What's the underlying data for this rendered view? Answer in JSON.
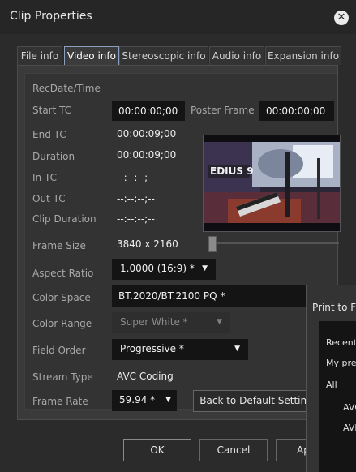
{
  "window": {
    "title": "Clip Properties",
    "close_icon": "close-icon"
  },
  "tabs": [
    {
      "label": "File info",
      "active": false
    },
    {
      "label": "Video info",
      "active": true
    },
    {
      "label": "Stereoscopic info",
      "active": false
    },
    {
      "label": "Audio info",
      "active": false
    },
    {
      "label": "Expansion info",
      "active": false
    }
  ],
  "fields": {
    "rec_datetime": {
      "label": "RecDate/Time"
    },
    "start_tc": {
      "label": "Start TC",
      "value": "00:00:00;00"
    },
    "poster_frame": {
      "label": "Poster Frame",
      "value": "00:00:00;00"
    },
    "end_tc": {
      "label": "End TC",
      "value": "00:00:09;00"
    },
    "duration": {
      "label": "Duration",
      "value": "00:00:09;00"
    },
    "in_tc": {
      "label": "In TC",
      "value": "--:--:--;--"
    },
    "out_tc": {
      "label": "Out TC",
      "value": "--:--:--;--"
    },
    "clip_duration": {
      "label": "Clip Duration",
      "value": "--:--:--;--"
    },
    "frame_size": {
      "label": "Frame Size",
      "value": "3840 x 2160"
    },
    "aspect_ratio": {
      "label": "Aspect Ratio",
      "value": "1.0000 (16:9) *"
    },
    "color_space": {
      "label": "Color Space",
      "value": "BT.2020/BT.2100 PQ *"
    },
    "color_range": {
      "label": "Color Range",
      "value": "Super White *"
    },
    "field_order": {
      "label": "Field Order",
      "value": "Progressive *"
    },
    "stream_type": {
      "label": "Stream Type",
      "value": "AVC Coding"
    },
    "frame_rate": {
      "label": "Frame Rate",
      "value": "59.94 *"
    }
  },
  "thumbnail": {
    "overlay_text": "EDIUS 9",
    "slider_position": 0
  },
  "buttons": {
    "back_to_default": "Back to Default Setting",
    "ok": "OK",
    "cancel": "Cancel",
    "apply": "Ap"
  },
  "background_window": {
    "title": "Print to F",
    "items": [
      "Recent",
      "My pres",
      "All",
      "AVC",
      "AVI"
    ]
  }
}
